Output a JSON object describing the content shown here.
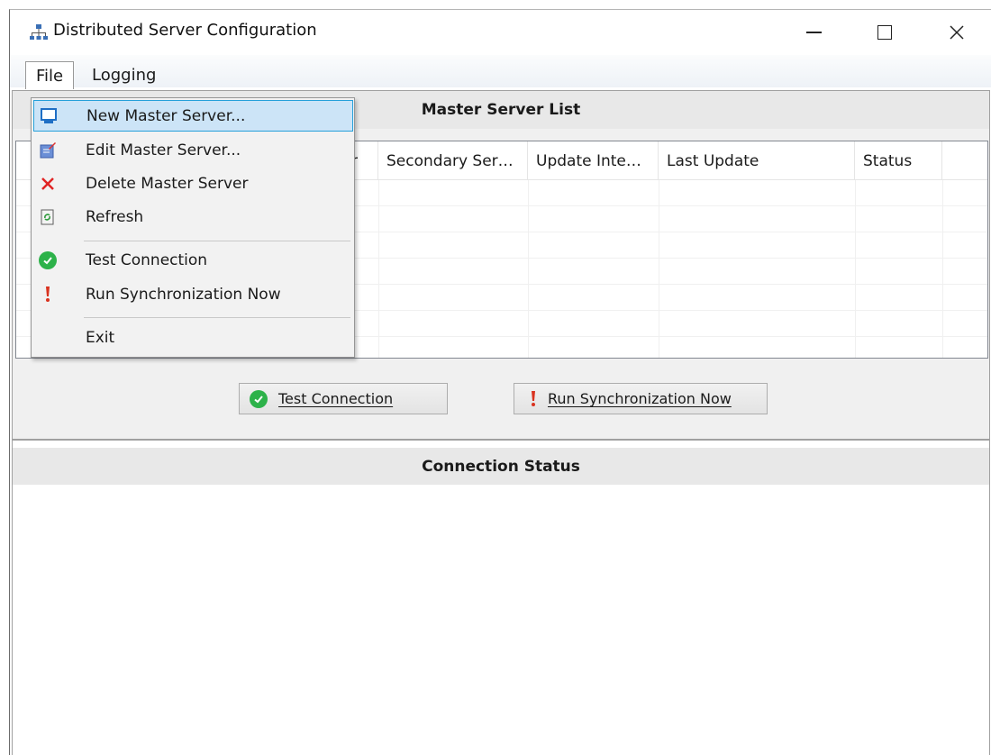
{
  "window": {
    "title": "Distributed Server Configuration",
    "minimize": "—",
    "maximize": "☐",
    "close": "✕"
  },
  "menubar": {
    "items": [
      {
        "label": "File"
      },
      {
        "label": "Logging"
      }
    ]
  },
  "file_menu": {
    "items": [
      {
        "label": "New Master Server...",
        "icon": "monitor-icon",
        "highlighted": true
      },
      {
        "label": "Edit Master Server...",
        "icon": "edit-icon"
      },
      {
        "label": "Delete Master Server",
        "icon": "delete-icon"
      },
      {
        "label": "Refresh",
        "icon": "refresh-icon"
      },
      {
        "label": "Test Connection",
        "icon": "check-icon"
      },
      {
        "label": "Run Synchronization Now",
        "icon": "exclamation-icon"
      },
      {
        "label": "Exit"
      }
    ]
  },
  "master_panel": {
    "title": "Master Server List",
    "columns": [
      "r",
      "Secondary Ser…",
      "Update Inte…",
      "Last Update",
      "Status"
    ]
  },
  "buttons": {
    "test_connection": "Test Connection",
    "run_sync": "Run Synchronization Now"
  },
  "connection_panel": {
    "title": "Connection Status"
  },
  "colors": {
    "highlight_bg": "#cce4f7",
    "highlight_border": "#26a0da",
    "check_green": "#2db24a",
    "delete_red": "#e02424",
    "exclaim_red": "#d9321f"
  }
}
